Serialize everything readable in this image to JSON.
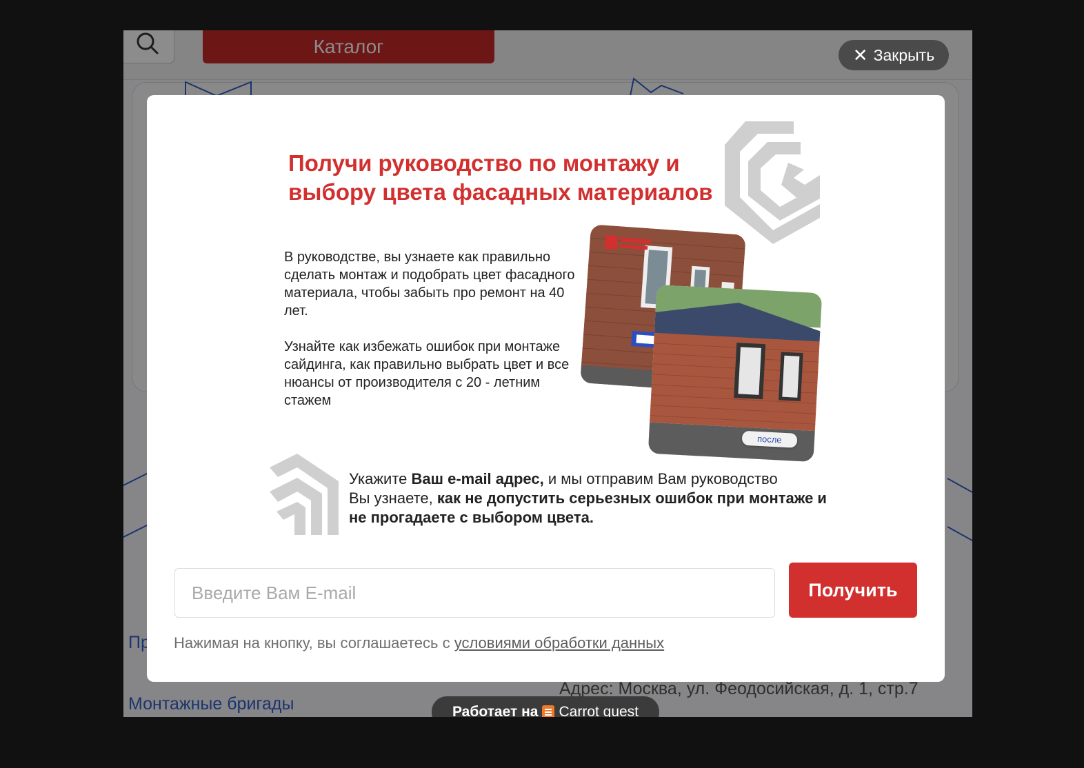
{
  "background": {
    "catalog_button": "Каталог",
    "link_partial": "Пр",
    "link_brigades": "Монтажные бригады",
    "address": "Адрес: Москва, ул. Феодосийская, д. 1, стр.7",
    "powered_prefix": "Работает на",
    "powered_brand": "Carrot quest",
    "icons": [
      "search-icon",
      "carrot-quest-icon"
    ]
  },
  "close_button": {
    "icon": "close-icon",
    "label": "Закрыть"
  },
  "modal": {
    "title": "Получи руководство по монтажу и выбору цвета фасадных материалов",
    "description": [
      "В руководстве, вы узнаете как правильно сделать монтаж и подобрать цвет фасадного материала, чтобы забыть про ремонт на 40 лет.",
      "Узнайте как избежать ошибок при монтаже сайдинга, как правильно выбрать цвет и все нюансы от производителя с 20 - летним стажем"
    ],
    "photo_before_label": "до",
    "photo_after_label": "после",
    "cta": {
      "line1_prefix": "Укажите ",
      "line1_bold": "Ваш e-mail адрес,",
      "line1_suffix": " и мы отправим Вам руководство",
      "line2_prefix": "Вы узнаете, ",
      "line2_bold": "как не допустить серьезных ошибок при монтаже и не прогадаете с выбором цвета."
    },
    "email_placeholder": "Введите Вам E-mail",
    "email_value": "",
    "submit_label": "Получить",
    "consent_text": "Нажимая на кнопку, вы соглашаетесь с ",
    "consent_link": "условиями обработки данных"
  },
  "colors": {
    "brand_red": "#d1302f",
    "overlay": "rgba(0,0,0,0.45)",
    "link_blue": "#2f5fc6"
  }
}
